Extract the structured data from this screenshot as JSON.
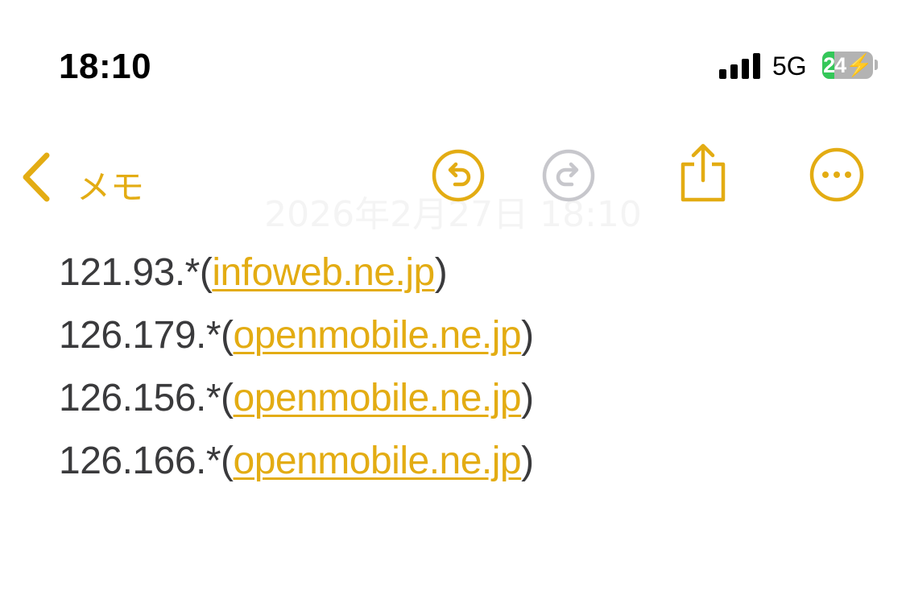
{
  "status_bar": {
    "time": "18:10",
    "network": "5G",
    "battery_level": "24",
    "battery_charging": true,
    "signal_bars": 4
  },
  "nav": {
    "back_label": "メモ",
    "date_ghost": "2026年2月27日 18:10",
    "icons": [
      "undo-icon",
      "redo-icon",
      "share-icon",
      "more-icon"
    ]
  },
  "note": {
    "lines": [
      {
        "prefix": "121.93.*(",
        "link": "infoweb.ne.jp",
        "suffix": ")"
      },
      {
        "prefix": "126.179.*(",
        "link": "openmobile.ne.jp",
        "suffix": ")"
      },
      {
        "prefix": "126.156.*(",
        "link": "openmobile.ne.jp",
        "suffix": ")"
      },
      {
        "prefix": "126.166.*(",
        "link": "openmobile.ne.jp",
        "suffix": ")"
      }
    ]
  },
  "colors": {
    "accent": "#e3ac13",
    "disabled": "#c7c7cc",
    "text": "#3a3a3c",
    "battery_green": "#34c759"
  }
}
